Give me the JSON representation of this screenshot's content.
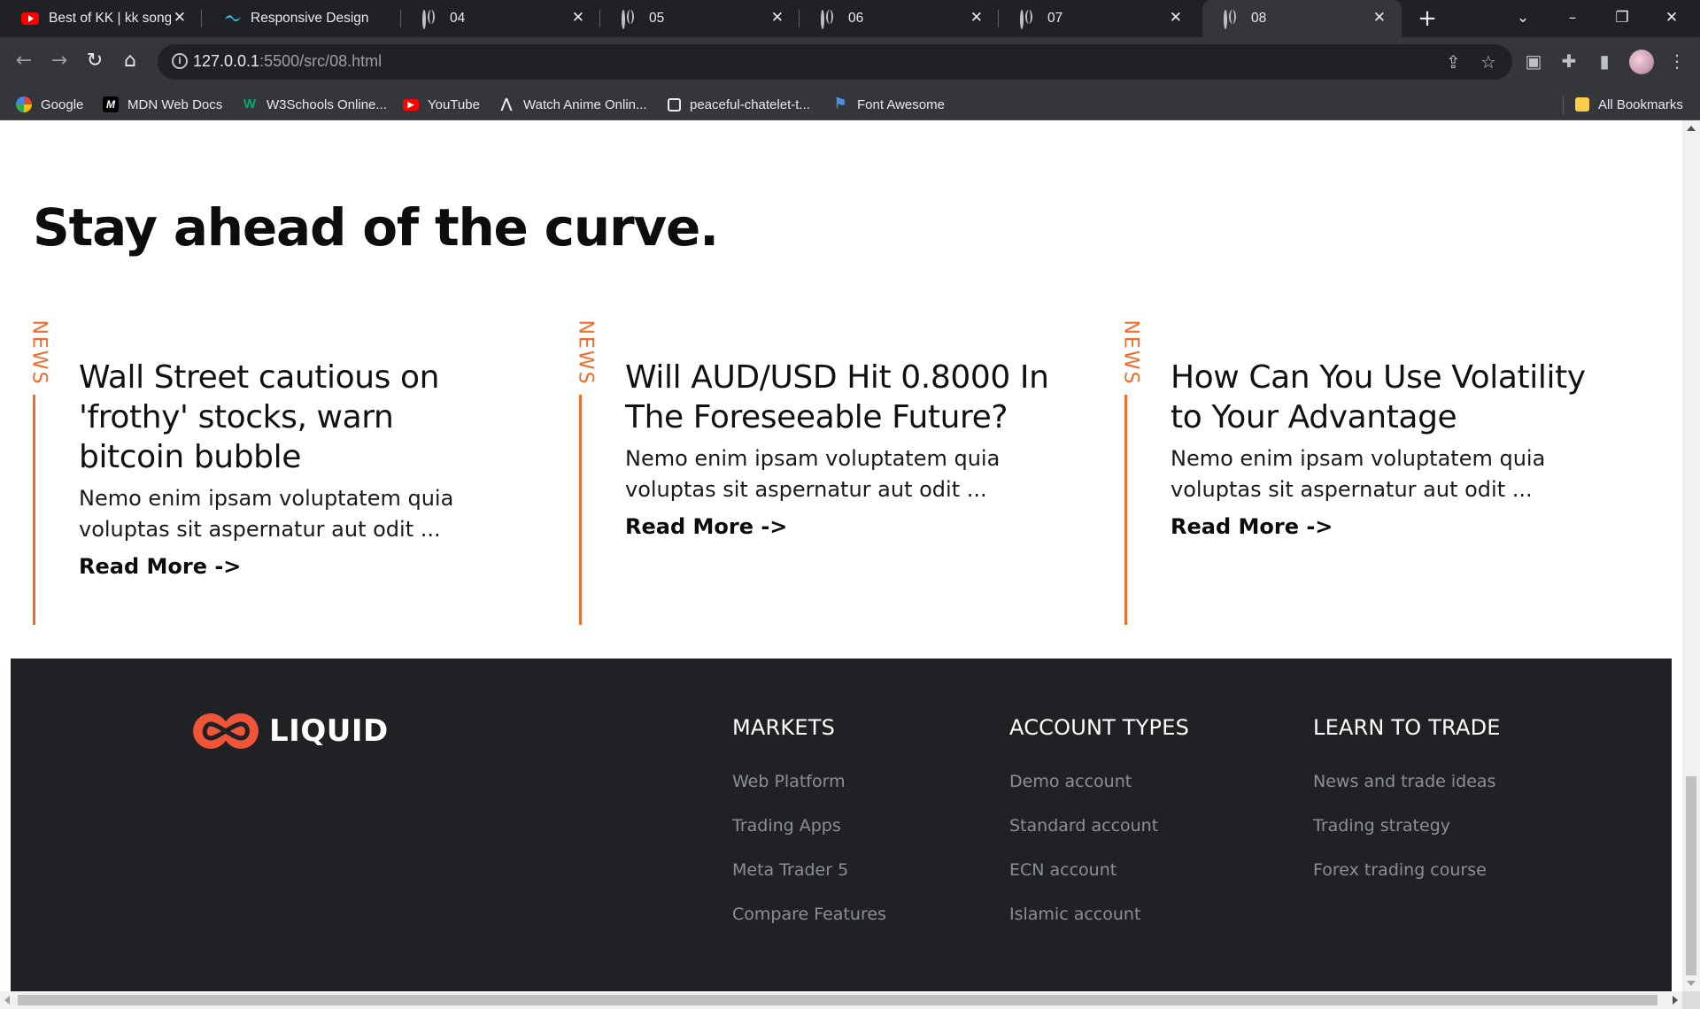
{
  "browser": {
    "tabs": [
      {
        "title": "Best of KK | kk songs",
        "icon": "youtube-icon"
      },
      {
        "title": "Responsive Design -",
        "icon": "tailwind-icon"
      },
      {
        "title": "04",
        "icon": "globe-icon"
      },
      {
        "title": "05",
        "icon": "globe-icon"
      },
      {
        "title": "06",
        "icon": "globe-icon"
      },
      {
        "title": "07",
        "icon": "globe-icon"
      },
      {
        "title": "08",
        "icon": "globe-icon",
        "active": true
      }
    ],
    "url_host": "127.0.0.1",
    "url_rest": ":5500/src/08.html",
    "bookmarks": [
      {
        "label": "Google",
        "icon": "google-icon"
      },
      {
        "label": "MDN Web Docs",
        "icon": "mdn-icon"
      },
      {
        "label": "W3Schools Online...",
        "icon": "w3schools-icon"
      },
      {
        "label": "YouTube",
        "icon": "youtube-icon"
      },
      {
        "label": "Watch Anime Onlin...",
        "icon": "anime-icon"
      },
      {
        "label": "peaceful-chatelet-t...",
        "icon": "page-icon"
      },
      {
        "label": "Font Awesome",
        "icon": "flag-icon"
      }
    ],
    "all_bookmarks": "All Bookmarks"
  },
  "page": {
    "headline": "Stay ahead of the curve.",
    "news_label": "NEWS",
    "accent_color": "#ef6c2b",
    "cards": [
      {
        "title": "Wall Street cautious on 'frothy' stocks, warn bitcoin bubble",
        "excerpt": "Nemo enim ipsam voluptatem quia voluptas sit aspernatur aut odit ...",
        "link": "Read More ->"
      },
      {
        "title": "Will AUD/USD Hit 0.8000 In The Foreseeable Future?",
        "excerpt": "Nemo enim ipsam voluptatem quia voluptas sit aspernatur aut odit ...",
        "link": "Read More ->"
      },
      {
        "title": "How Can You Use Volatility to Your Advantage",
        "excerpt": "Nemo enim ipsam voluptatem quia voluptas sit aspernatur aut odit ...",
        "link": "Read More ->"
      }
    ],
    "footer": {
      "brand": "LIQUID",
      "brand_color": "#f0553a",
      "columns": [
        {
          "heading": "MARKETS",
          "links": [
            "Web Platform",
            "Trading Apps",
            "Meta Trader 5",
            "Compare Features"
          ]
        },
        {
          "heading": "ACCOUNT TYPES",
          "links": [
            "Demo account",
            "Standard account",
            "ECN account",
            "Islamic account"
          ]
        },
        {
          "heading": "LEARN TO TRADE",
          "links": [
            "News and trade ideas",
            "Trading strategy",
            "Forex trading course"
          ]
        }
      ]
    }
  }
}
